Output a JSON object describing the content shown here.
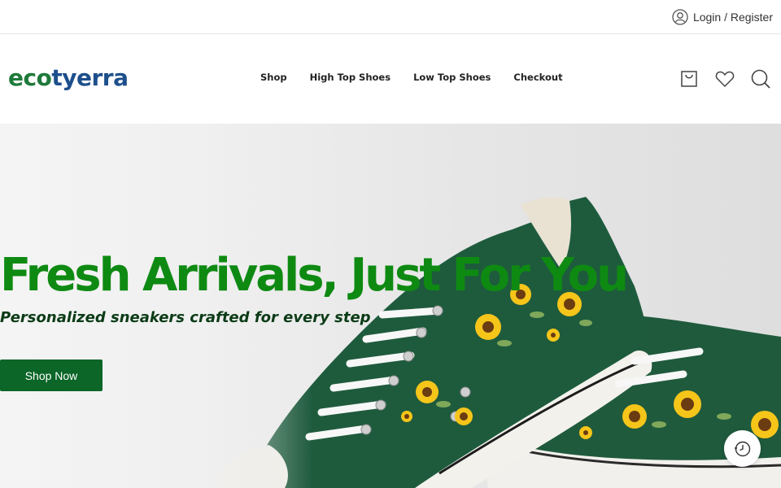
{
  "topbar": {
    "login_label": "Login / Register"
  },
  "header": {
    "logo_part1": "eco",
    "logo_part2": "tyerra",
    "nav": [
      "Shop",
      "High Top Shoes",
      "Low Top Shoes",
      "Checkout"
    ],
    "icons": [
      "cart-icon",
      "heart-icon",
      "search-icon"
    ]
  },
  "hero": {
    "title": "Fresh Arrivals, Just For You",
    "subtitle": "Personalized sneakers crafted for every step",
    "cta_label": "Shop Now"
  },
  "floating": {
    "icon": "history-clock-icon"
  },
  "colors": {
    "logo_green": "#1e7a3a",
    "logo_blue": "#1d4f8c",
    "title_green": "#0e8a12",
    "subtitle_green": "#0b3b16",
    "button_green": "#0b6627"
  }
}
